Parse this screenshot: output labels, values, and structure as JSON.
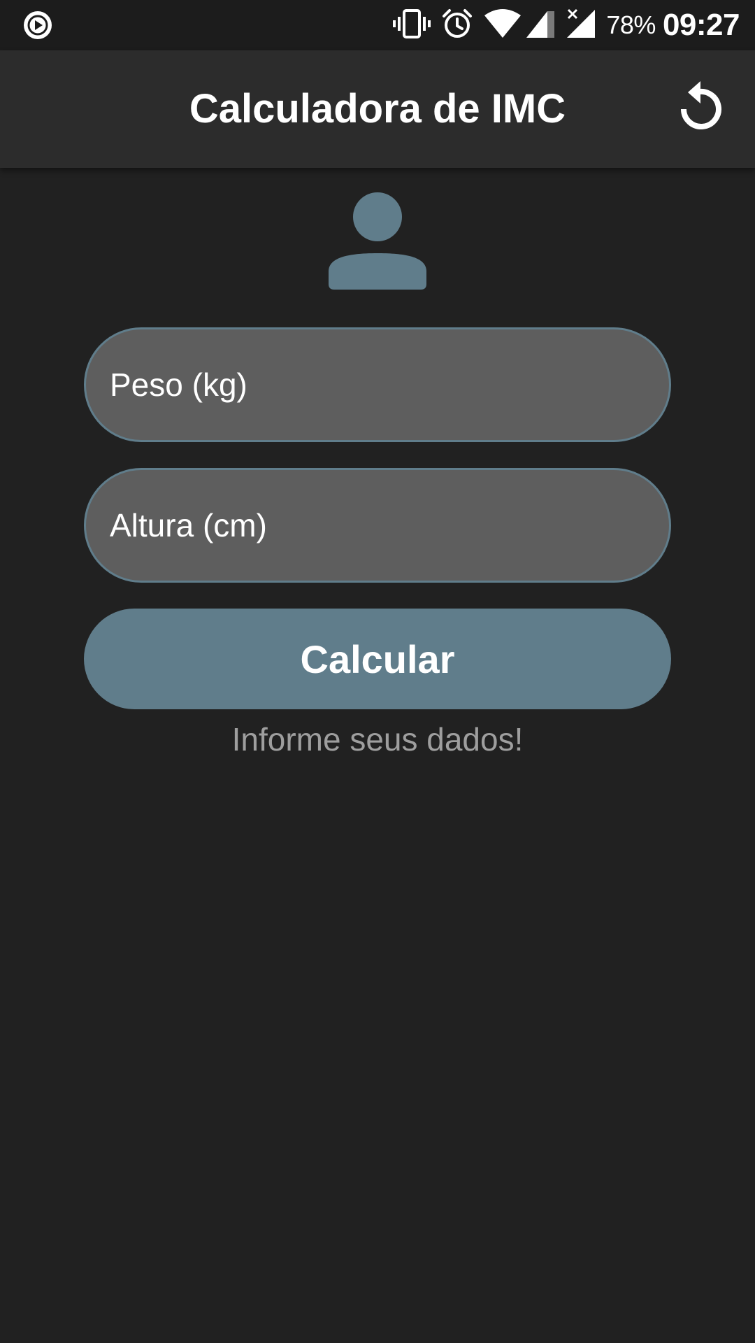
{
  "status_bar": {
    "battery": "78%",
    "time": "09:27",
    "icons": [
      "play-circle-icon",
      "vibrate-icon",
      "alarm-icon",
      "wifi-icon",
      "signal-icon",
      "signal-no-sim-icon"
    ]
  },
  "app_bar": {
    "title": "Calculadora de IMC",
    "refresh_icon": "refresh-icon"
  },
  "form": {
    "avatar_icon": "person-icon",
    "weight": {
      "placeholder": "Peso (kg)",
      "value": ""
    },
    "height": {
      "placeholder": "Altura (cm)",
      "value": ""
    },
    "calculate_label": "Calcular",
    "info_text": "Informe seus dados!"
  },
  "colors": {
    "background": "#212121",
    "app_bar": "#2c2c2c",
    "accent": "#607d8b",
    "input_fill": "#5e5e5e",
    "info_text": "#9e9e9e"
  }
}
